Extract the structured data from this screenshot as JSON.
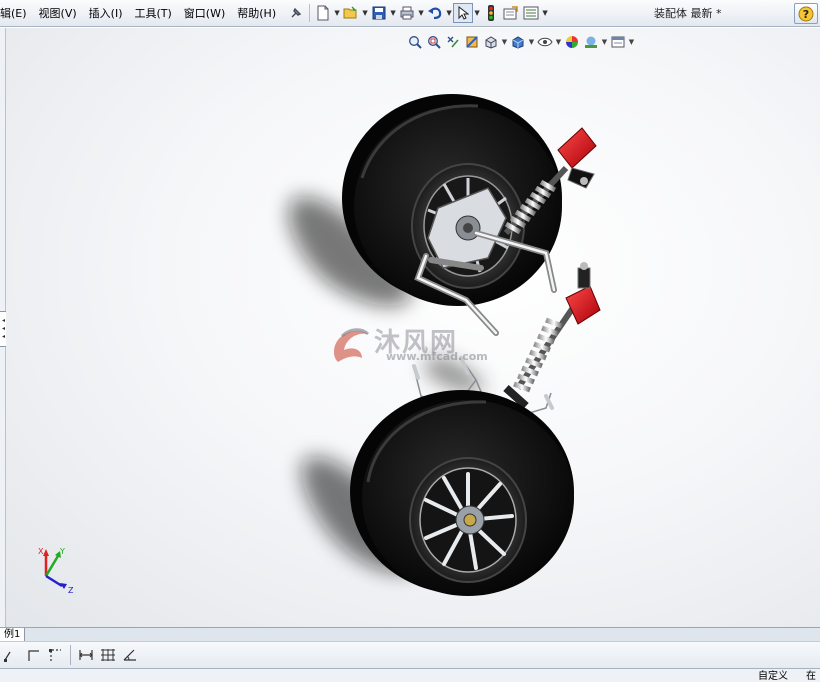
{
  "menu": {
    "items": [
      {
        "label": "辑(E)"
      },
      {
        "label": "视图(V)"
      },
      {
        "label": "插入(I)"
      },
      {
        "label": "工具(T)"
      },
      {
        "label": "窗口(W)"
      },
      {
        "label": "帮助(H)"
      }
    ]
  },
  "toolbar": {
    "buttons": [
      "pin-icon",
      "new-document-icon",
      "open-folder-icon",
      "save-icon",
      "print-icon",
      "undo-icon",
      "select-pointer-icon",
      "rebuild-traffic-light-icon",
      "file-properties-icon",
      "options-icon"
    ]
  },
  "document": {
    "title": "装配体 最新 *"
  },
  "view_toolbar": {
    "buttons": [
      "zoom-to-fit-icon",
      "zoom-to-area-icon",
      "previous-view-icon",
      "section-view-icon",
      "view-orientation-icon",
      "display-style-icon",
      "hide-show-items-icon",
      "edit-appearance-icon",
      "apply-scene-icon",
      "view-settings-icon"
    ]
  },
  "watermark": {
    "text": "沐风网",
    "url": "www.mfcad.com"
  },
  "triad": {
    "x_label": "X",
    "y_label": "Y",
    "z_label": "Z"
  },
  "tabs": {
    "active_label": "例1"
  },
  "sketch_toolbar": {
    "buttons": [
      "sketch-line-icon",
      "sketch-corner-icon",
      "sketch-centerline-icon",
      "smart-dimension-icon",
      "grid-icon",
      "angle-icon"
    ]
  },
  "status": {
    "custom": "自定义",
    "extra": "在"
  },
  "colors": {
    "accent_red": "#e0101a",
    "tire": "#111111",
    "chrome": "#c8ccd2",
    "background": "#ffffff"
  }
}
